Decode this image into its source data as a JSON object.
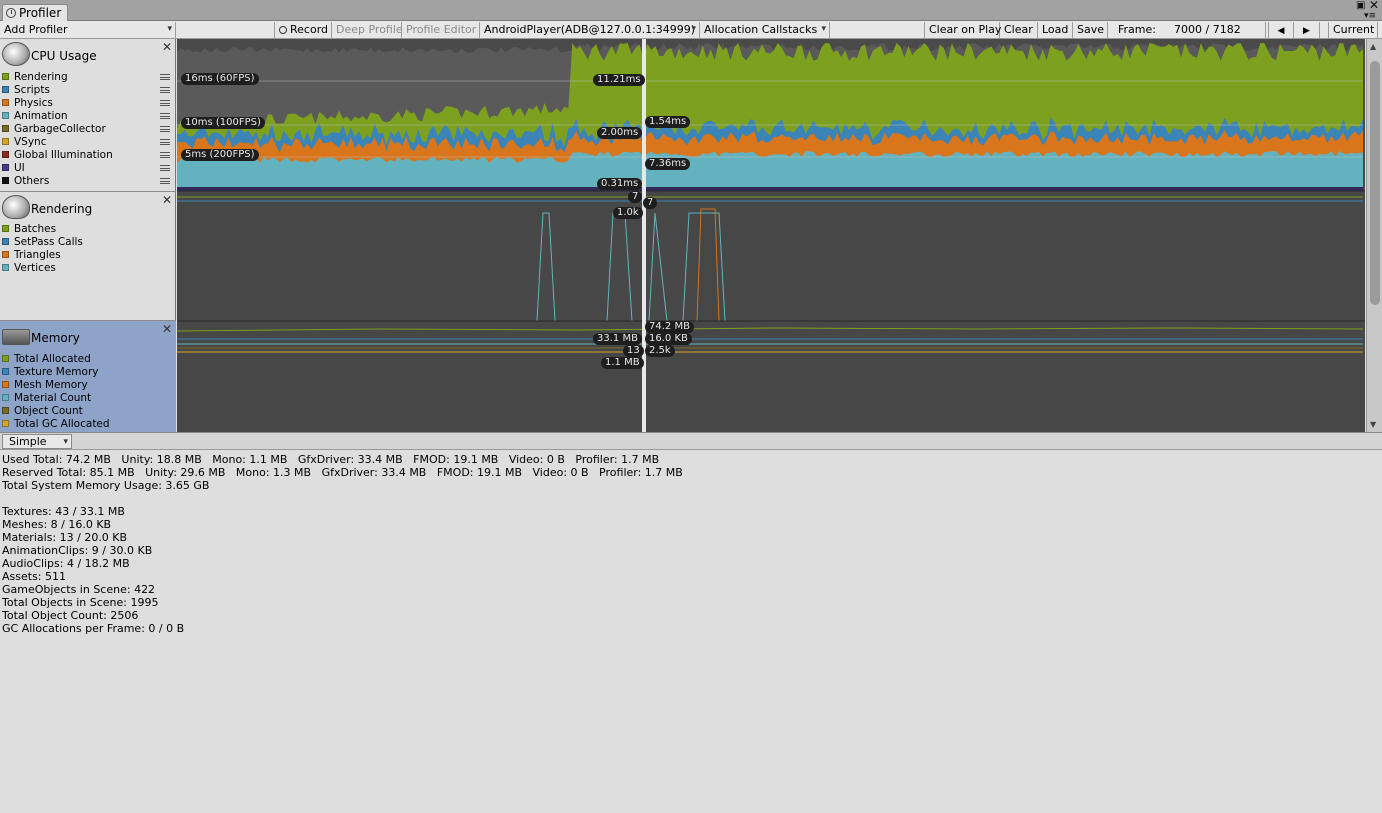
{
  "window": {
    "tab_title": "Profiler"
  },
  "toolbar": {
    "add_profiler": "Add Profiler",
    "record": "Record",
    "deep_profile": "Deep Profile",
    "profile_editor": "Profile Editor",
    "target": "AndroidPlayer(ADB@127.0.0.1:34999)",
    "allocation": "Allocation Callstacks",
    "clear_on_play": "Clear on Play",
    "clear": "Clear",
    "load": "Load",
    "save": "Save",
    "frame_label": "Frame:",
    "frame_value": "7000 / 7182",
    "prev_icon": "triangle-left-icon",
    "next_icon": "triangle-right-icon",
    "current": "Current"
  },
  "modules": {
    "cpu": {
      "title": "CPU Usage",
      "items": [
        {
          "label": "Rendering",
          "color": "#7da01f"
        },
        {
          "label": "Scripts",
          "color": "#3b84b8"
        },
        {
          "label": "Physics",
          "color": "#d9751a"
        },
        {
          "label": "Animation",
          "color": "#62b3bf"
        },
        {
          "label": "GarbageCollector",
          "color": "#7a6a24"
        },
        {
          "label": "VSync",
          "color": "#d3a52a"
        },
        {
          "label": "Global Illumination",
          "color": "#8e2a1f"
        },
        {
          "label": "UI",
          "color": "#4d3a8a"
        },
        {
          "label": "Others",
          "color": "#111111"
        }
      ]
    },
    "rendering": {
      "title": "Rendering",
      "items": [
        {
          "label": "Batches",
          "color": "#7da01f"
        },
        {
          "label": "SetPass Calls",
          "color": "#3b84b8"
        },
        {
          "label": "Triangles",
          "color": "#d9751a"
        },
        {
          "label": "Vertices",
          "color": "#62b3bf"
        }
      ]
    },
    "memory": {
      "title": "Memory",
      "items": [
        {
          "label": "Total Allocated",
          "color": "#7da01f"
        },
        {
          "label": "Texture Memory",
          "color": "#3b84b8"
        },
        {
          "label": "Mesh Memory",
          "color": "#d9751a"
        },
        {
          "label": "Material Count",
          "color": "#62b3bf"
        },
        {
          "label": "Object Count",
          "color": "#7a6a24"
        },
        {
          "label": "Total GC Allocated",
          "color": "#d3a52a"
        }
      ]
    }
  },
  "graph_labels": {
    "cpu_16ms": "16ms (60FPS)",
    "cpu_10ms": "10ms (100FPS)",
    "cpu_5ms": "5ms (200FPS)",
    "cpu_rendering": "11.21ms",
    "cpu_scripts": "1.54ms",
    "cpu_physics": "2.00ms",
    "cpu_animation": "7.36ms",
    "cpu_others": "0.31ms",
    "rend_batches": "7",
    "rend_setpass": "7",
    "rend_vertices": "1.0k",
    "mem_total": "74.2 MB",
    "mem_texture": "33.1 MB",
    "mem_mesh": "16.0 KB",
    "mem_material": "13",
    "mem_object": "2.5k",
    "mem_gc": "1.1 MB"
  },
  "detail_view": {
    "mode": "Simple"
  },
  "details": [
    "Used Total: 74.2 MB   Unity: 18.8 MB   Mono: 1.1 MB   GfxDriver: 33.4 MB   FMOD: 19.1 MB   Video: 0 B   Profiler: 1.7 MB",
    "Reserved Total: 85.1 MB   Unity: 29.6 MB   Mono: 1.3 MB   GfxDriver: 33.4 MB   FMOD: 19.1 MB   Video: 0 B   Profiler: 1.7 MB",
    "Total System Memory Usage: 3.65 GB",
    "",
    "Textures: 43 / 33.1 MB",
    "Meshes: 8 / 16.0 KB",
    "Materials: 13 / 20.0 KB",
    "AnimationClips: 9 / 30.0 KB",
    "AudioClips: 4 / 18.2 MB",
    "Assets: 511",
    "GameObjects in Scene: 422",
    "Total Objects in Scene: 1995",
    "Total Object Count: 2506",
    "GC Allocations per Frame: 0 / 0 B"
  ]
}
